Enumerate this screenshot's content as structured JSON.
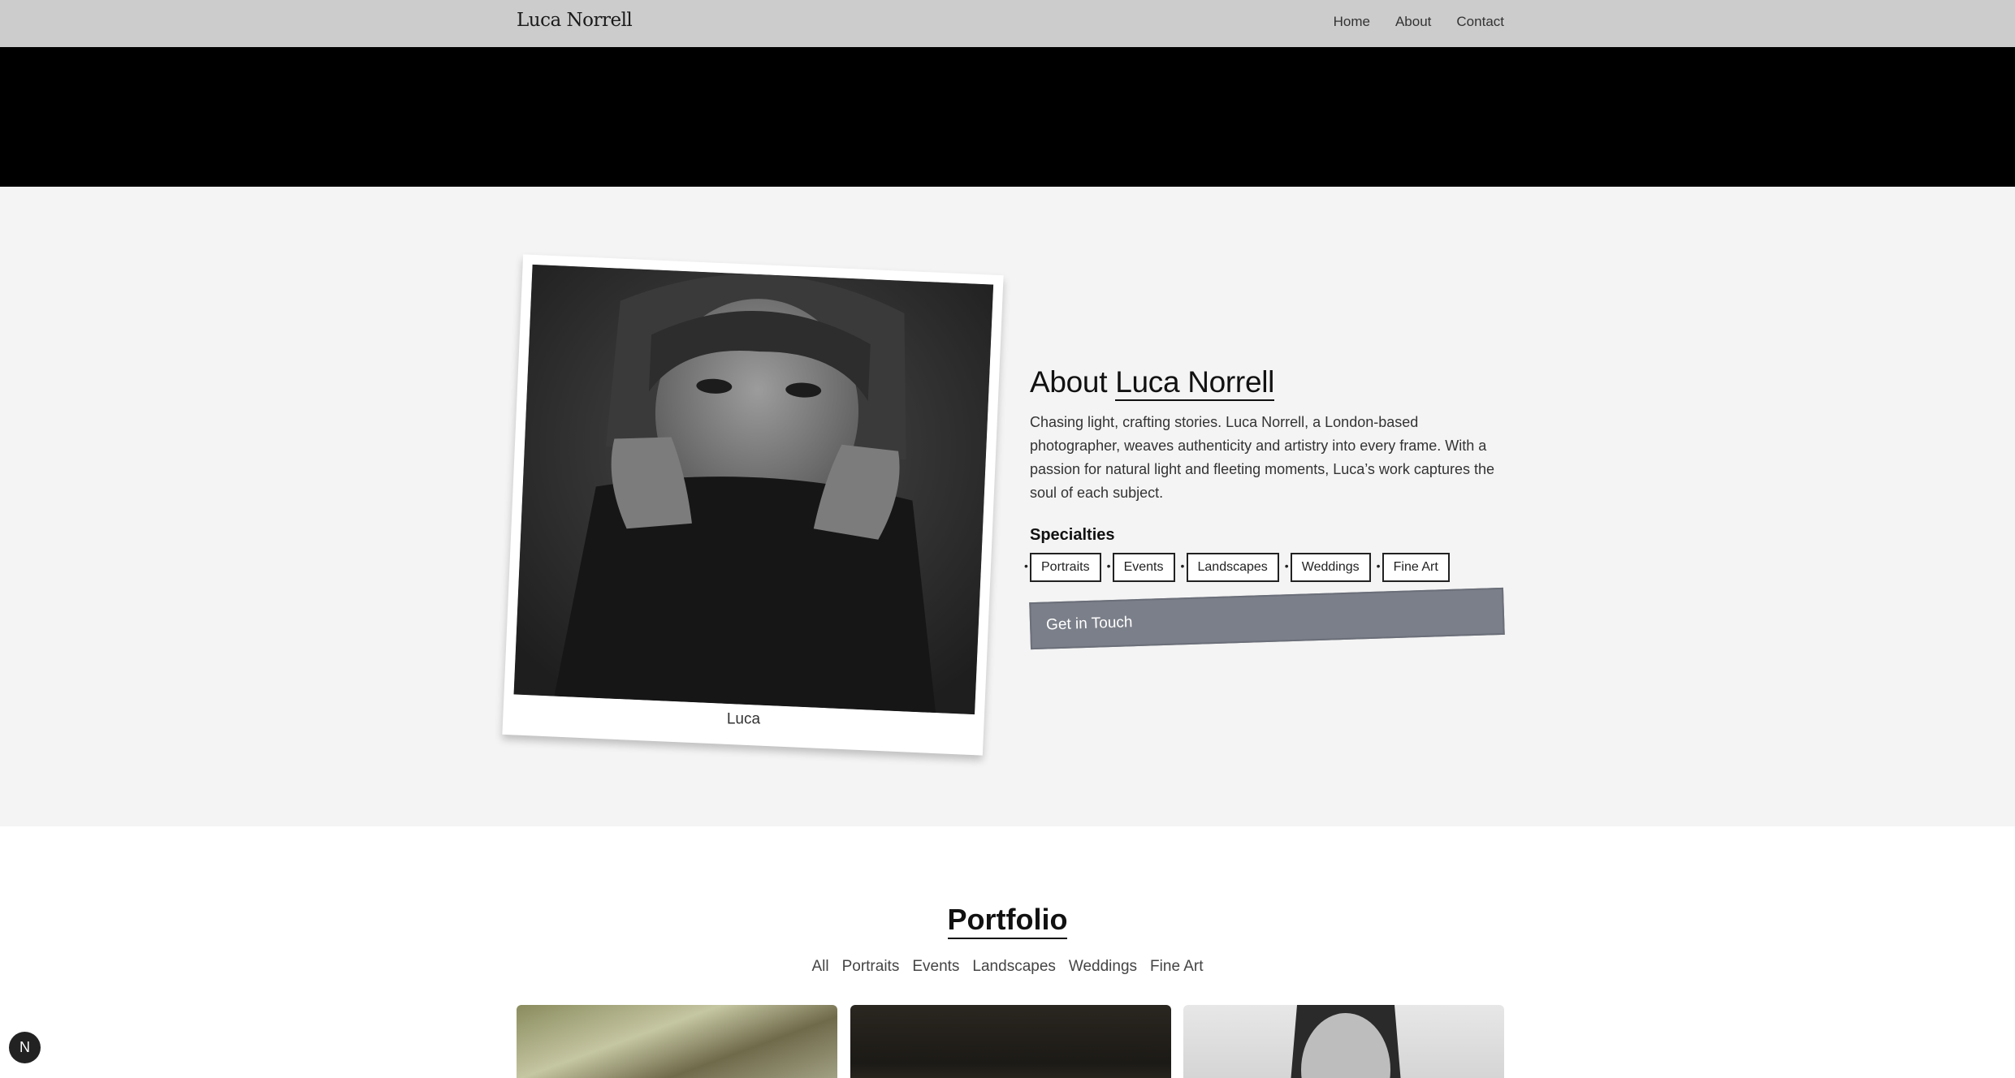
{
  "navbar": {
    "brand": "Luca Norrell",
    "links": [
      "Home",
      "About",
      "Contact"
    ]
  },
  "about": {
    "title_prefix": "About",
    "title_name": "Luca Norrell",
    "description": "Chasing light, crafting stories. Luca Norrell, a London-based photographer, weaves authenticity and artistry into every frame. With a passion for natural light and fleeting moments, Luca’s work captures the soul of each subject.",
    "photo_caption": "Luca",
    "specialties_heading": "Specialties",
    "specialties": [
      "Portraits",
      "Events",
      "Landscapes",
      "Weddings",
      "Fine Art"
    ],
    "cta_label": "Get in Touch"
  },
  "portfolio": {
    "title": "Portfolio",
    "filters": [
      "All",
      "Portraits",
      "Events",
      "Landscapes",
      "Weddings",
      "Fine Art"
    ]
  },
  "badge": {
    "label": "N",
    "icon": "next-logo-icon"
  }
}
